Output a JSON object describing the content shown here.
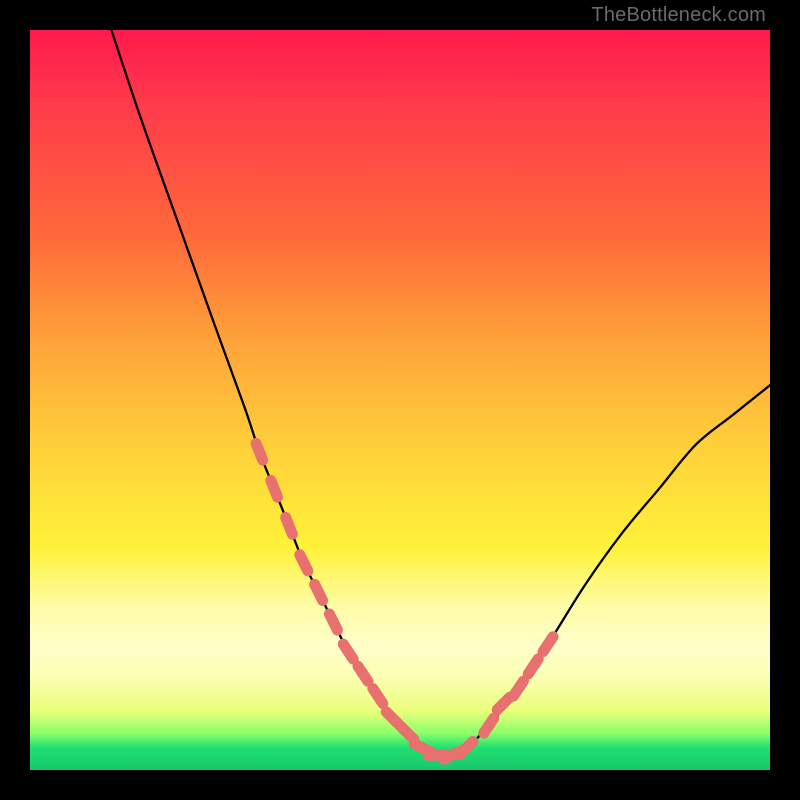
{
  "watermark": "TheBottleneck.com",
  "chart_data": {
    "type": "line",
    "title": "",
    "xlabel": "",
    "ylabel": "",
    "xlim": [
      0,
      100
    ],
    "ylim": [
      0,
      100
    ],
    "series": [
      {
        "name": "curve",
        "x": [
          11,
          15,
          20,
          25,
          29,
          31,
          33,
          35,
          37,
          39,
          41,
          43,
          45,
          47,
          49,
          51,
          53,
          55,
          57,
          59,
          62,
          66,
          70,
          75,
          80,
          85,
          90,
          95,
          100
        ],
        "y": [
          100,
          88,
          74,
          60,
          49,
          43,
          38,
          33,
          28,
          24,
          20,
          16,
          13,
          10,
          7,
          5,
          3,
          2,
          2,
          3,
          6,
          11,
          17,
          25,
          32,
          38,
          44,
          48,
          52
        ]
      }
    ],
    "markers": [
      {
        "x": 31,
        "y": 43
      },
      {
        "x": 33,
        "y": 38
      },
      {
        "x": 35,
        "y": 33
      },
      {
        "x": 37,
        "y": 28
      },
      {
        "x": 39,
        "y": 24
      },
      {
        "x": 41,
        "y": 20
      },
      {
        "x": 43,
        "y": 16
      },
      {
        "x": 45,
        "y": 13
      },
      {
        "x": 47,
        "y": 10
      },
      {
        "x": 49,
        "y": 7
      },
      {
        "x": 51,
        "y": 5
      },
      {
        "x": 53,
        "y": 3
      },
      {
        "x": 55,
        "y": 2
      },
      {
        "x": 57,
        "y": 2
      },
      {
        "x": 59,
        "y": 3
      },
      {
        "x": 62,
        "y": 6
      },
      {
        "x": 64,
        "y": 9
      },
      {
        "x": 66,
        "y": 11
      },
      {
        "x": 68,
        "y": 14
      },
      {
        "x": 70,
        "y": 17
      }
    ],
    "colors": {
      "curve": "#000000",
      "markers": "#e8716f",
      "gradient_top": "#ff1a4d",
      "gradient_bottom": "#18c76c"
    }
  }
}
